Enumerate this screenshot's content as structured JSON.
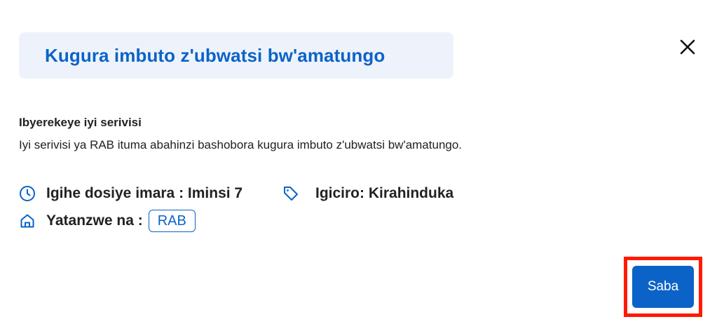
{
  "dialog": {
    "title": "Kugura imbuto z'ubwatsi bw'amatungo",
    "close_icon": "close-icon"
  },
  "about": {
    "heading": "Ibyerekeye iyi serivisi",
    "description": "Iyi serivisi ya RAB ituma abahinzi bashobora kugura imbuto z'ubwatsi bw'amatungo."
  },
  "meta": {
    "processing_time": {
      "icon": "clock-icon",
      "label": "Igihe dosiye imara : Iminsi 7"
    },
    "price": {
      "icon": "tag-icon",
      "label": "Igiciro: Kirahinduka"
    },
    "provider": {
      "icon": "building-icon",
      "label": "Yatanzwe na :",
      "value": "RAB"
    }
  },
  "actions": {
    "apply_label": "Saba"
  },
  "colors": {
    "accent": "#0b63c8",
    "title_bg": "#eef3fb",
    "highlight": "#ff1a00"
  }
}
